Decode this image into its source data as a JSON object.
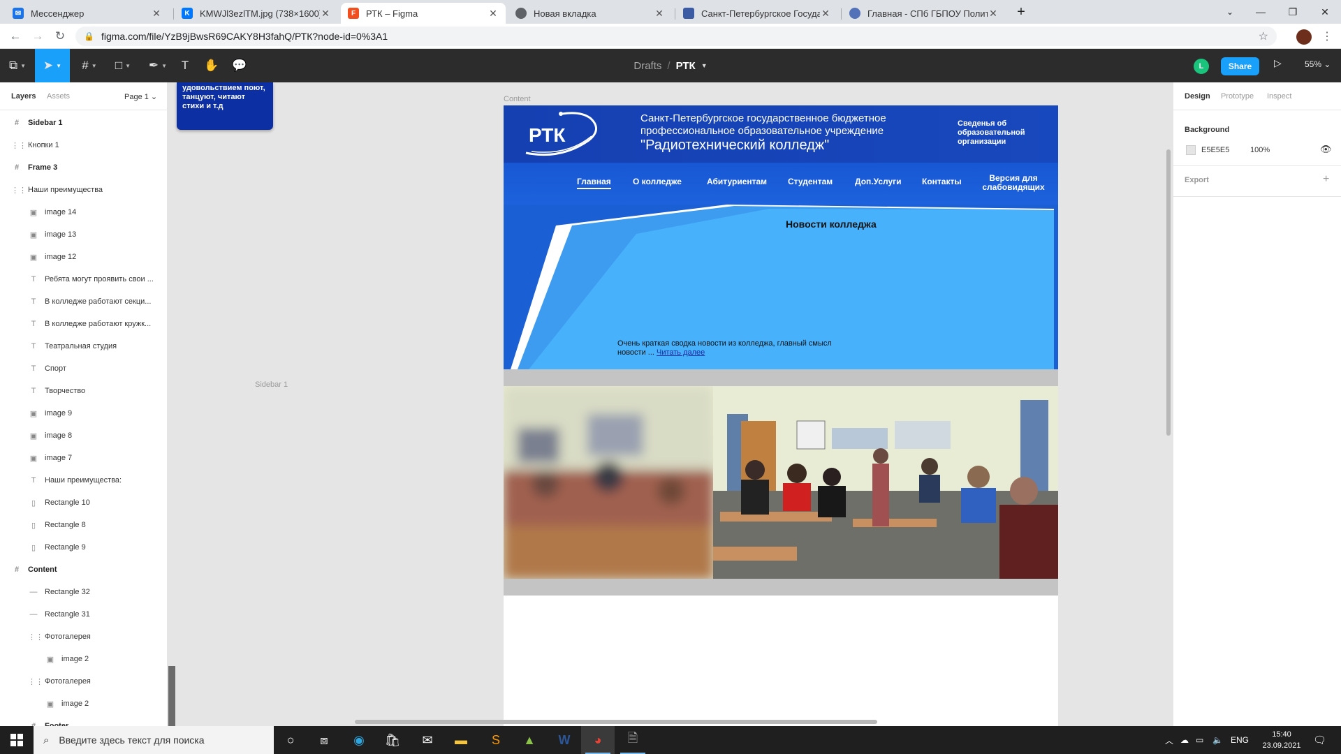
{
  "browser": {
    "tabs": [
      {
        "label": "Мессенджер",
        "favicon_color": "#1a73e8",
        "icon": "messenger-icon"
      },
      {
        "label": "KMWJl3ezlTM.jpg (738×1600)",
        "favicon_color": "#0077ff",
        "icon": "vk-icon"
      },
      {
        "label": "РТК – Figma",
        "favicon_color": "#f24e1e",
        "icon": "figma-icon",
        "active": true
      },
      {
        "label": "Новая вкладка",
        "favicon_color": "#5f6368",
        "icon": "chrome-icon"
      },
      {
        "label": "Санкт-Петербургское Государс",
        "favicon_color": "#3b5ba5",
        "icon": "site-icon"
      },
      {
        "label": "Главная - СПб ГБПОУ Политехн",
        "favicon_color": "#5271b8",
        "icon": "site-icon"
      }
    ],
    "url": "figma.com/file/YzB9jBwsR69CAKY8H3fahQ/РТК?node-id=0%3A1"
  },
  "figma": {
    "breadcrumb_drafts": "Drafts",
    "breadcrumb_sep": "/",
    "file_name": "РТК",
    "user_initial": "L",
    "share_label": "Share",
    "zoom": "55%",
    "left_tabs": {
      "layers": "Layers",
      "assets": "Assets",
      "page": "Page 1"
    },
    "layers": [
      {
        "label": "Sidebar 1",
        "type": "frame",
        "indent": 0
      },
      {
        "label": "Кнопки 1",
        "type": "group",
        "indent": 0
      },
      {
        "label": "Frame 3",
        "type": "frame",
        "indent": 0
      },
      {
        "label": "Наши преимущества",
        "type": "group",
        "indent": 0
      },
      {
        "label": "image 14",
        "type": "image",
        "indent": 1
      },
      {
        "label": "image 13",
        "type": "image",
        "indent": 1
      },
      {
        "label": "image 12",
        "type": "image",
        "indent": 1
      },
      {
        "label": "Ребята могут проявить свои ...",
        "type": "text",
        "indent": 1
      },
      {
        "label": "В колледже работают секци...",
        "type": "text",
        "indent": 1
      },
      {
        "label": "В колледже работают кружк...",
        "type": "text",
        "indent": 1
      },
      {
        "label": "Театральная студия",
        "type": "text",
        "indent": 1
      },
      {
        "label": "Спорт",
        "type": "text",
        "indent": 1
      },
      {
        "label": "Творчество",
        "type": "text",
        "indent": 1
      },
      {
        "label": "image 9",
        "type": "image",
        "indent": 1
      },
      {
        "label": "image 8",
        "type": "image",
        "indent": 1
      },
      {
        "label": "image 7",
        "type": "image",
        "indent": 1
      },
      {
        "label": "Наши преимущества:",
        "type": "text",
        "indent": 1
      },
      {
        "label": "Rectangle 10",
        "type": "rect",
        "indent": 1
      },
      {
        "label": "Rectangle 8",
        "type": "rect",
        "indent": 1
      },
      {
        "label": "Rectangle 9",
        "type": "rect",
        "indent": 1
      },
      {
        "label": "Content",
        "type": "frame",
        "indent": 0
      },
      {
        "label": "Rectangle 32",
        "type": "line",
        "indent": 1
      },
      {
        "label": "Rectangle 31",
        "type": "line",
        "indent": 1
      },
      {
        "label": "Фотогалерея",
        "type": "group",
        "indent": 1
      },
      {
        "label": "image 2",
        "type": "image",
        "indent": 2
      },
      {
        "label": "Фотогалерея",
        "type": "group",
        "indent": 1
      },
      {
        "label": "image 2",
        "type": "image",
        "indent": 2
      },
      {
        "label": "Footer",
        "type": "frame",
        "indent": 1
      }
    ],
    "canvas": {
      "sidebar_text": "удовольствием поют, танцуют, читают стихи и т.д",
      "frame_label": "Content",
      "sidebar_label": "Sidebar 1"
    },
    "site": {
      "logo_text": "РТК",
      "org_line1": "Санкт-Петербургское государственное бюджетное",
      "org_line2": "профессиональное образовательное учреждение",
      "org_line3": "\"Радиотехнический колледж\"",
      "org_info": "Сведенья об образовательной организации",
      "nav": [
        "Главная",
        "О колледже",
        "Абитуриентам",
        "Студентам",
        "Доп.Услуги",
        "Контакты"
      ],
      "nav_vision": "Версия для слабовидящих",
      "news_title": "Новости колледжа",
      "news_summary": "Очень краткая сводка новости из колледжа, главный смысл новости ...",
      "news_more": "Читать далее"
    },
    "right_panel": {
      "tabs": [
        "Design",
        "Prototype",
        "Inspect"
      ],
      "background_label": "Background",
      "bg_color": "E5E5E5",
      "bg_opacity": "100%",
      "export_label": "Export"
    }
  },
  "taskbar": {
    "search_placeholder": "Введите здесь текст для поиска",
    "lang": "ENG",
    "time": "15:40",
    "date": "23.09.2021"
  }
}
